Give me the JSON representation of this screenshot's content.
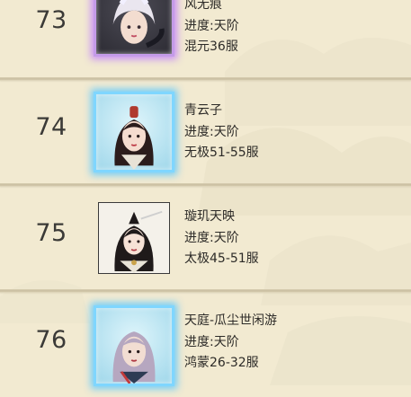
{
  "entries": [
    {
      "rank": "73",
      "name": "风无痕",
      "progress": "进度:天阶",
      "outfit": "混元36服",
      "frame": "purple"
    },
    {
      "rank": "74",
      "name": "青云子",
      "progress": "进度:天阶",
      "outfit": "无极51-55服",
      "frame": "cyan"
    },
    {
      "rank": "75",
      "name": "璇玑天映",
      "progress": "进度:天阶",
      "outfit": "太极45-51服",
      "frame": "plain"
    },
    {
      "rank": "76",
      "name": "天庭-瓜尘世闲游",
      "progress": "进度:天阶",
      "outfit": "鸿蒙26-32服",
      "frame": "cyan"
    }
  ],
  "colors": {
    "background": "#efe7cf",
    "text": "#2d2b28",
    "frame_purple": "#c49be8",
    "frame_cyan": "#7fd6ff"
  }
}
